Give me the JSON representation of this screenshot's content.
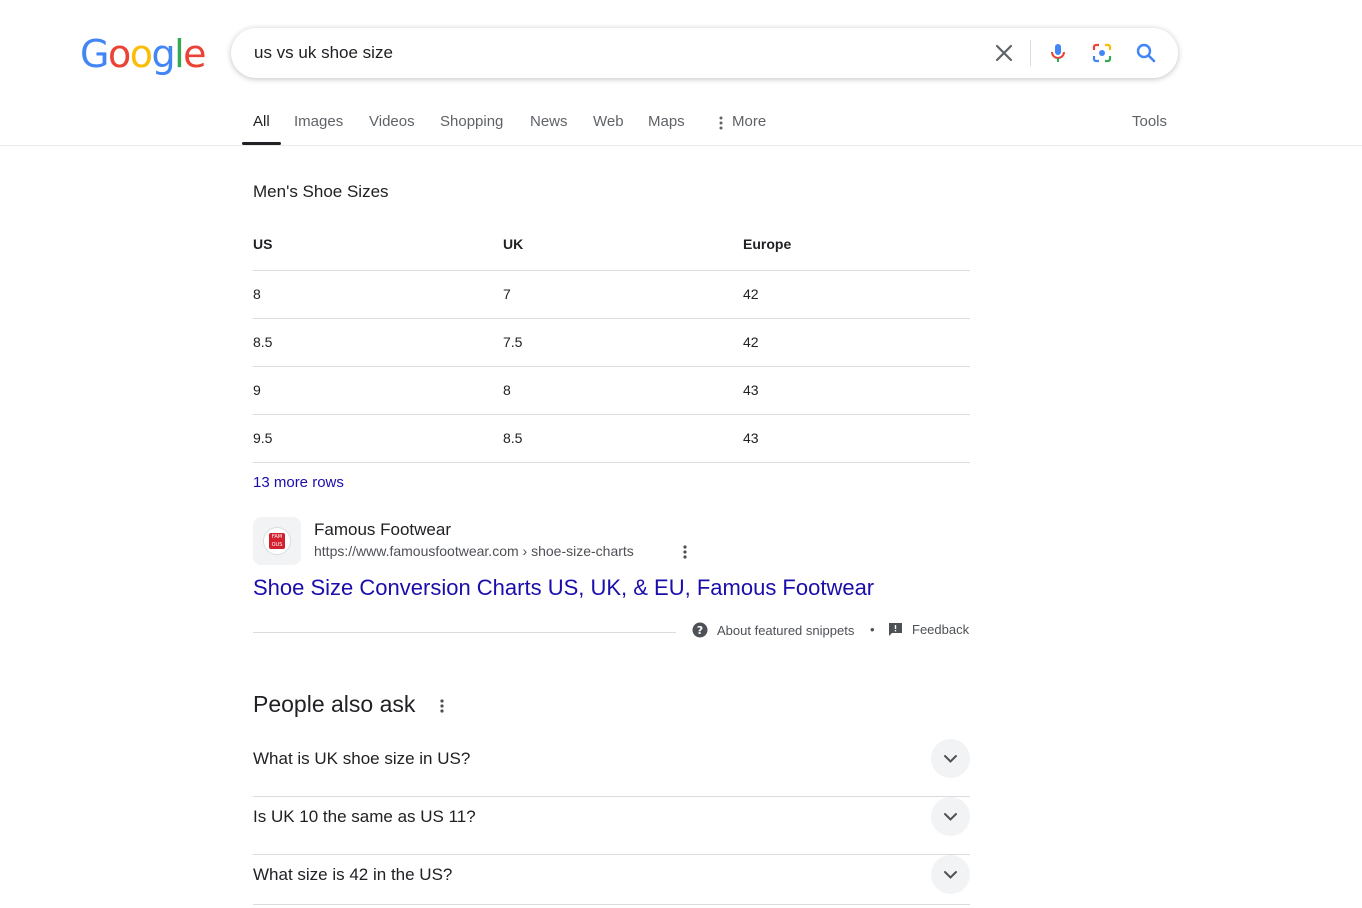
{
  "logo": {
    "text": "Google"
  },
  "search": {
    "query": "us vs uk shoe size"
  },
  "tabs": [
    {
      "label": "All"
    },
    {
      "label": "Images"
    },
    {
      "label": "Videos"
    },
    {
      "label": "Shopping"
    },
    {
      "label": "News"
    },
    {
      "label": "Web"
    },
    {
      "label": "Maps"
    },
    {
      "label": "More"
    }
  ],
  "tools_label": "Tools",
  "snippet": {
    "title": "Men's Shoe Sizes",
    "headers": [
      "US",
      "UK",
      "Europe"
    ],
    "rows": [
      [
        "8",
        "7",
        "42"
      ],
      [
        "8.5",
        "7.5",
        "42"
      ],
      [
        "9",
        "8",
        "43"
      ],
      [
        "9.5",
        "8.5",
        "43"
      ]
    ],
    "more_rows": "13 more rows",
    "favicon_text": "FAMOUS",
    "site_name": "Famous Footwear",
    "url": "https://www.famousfootwear.com › shoe-size-charts",
    "result_title": "Shoe Size Conversion Charts US, UK, & EU, Famous Footwear",
    "about_label": "About featured snippets",
    "separator": "•",
    "feedback_label": "Feedback"
  },
  "paa": {
    "title": "People also ask",
    "questions": [
      "What is UK shoe size in US?",
      "Is UK 10 the same as US 11?",
      "What size is 42 in the US?"
    ]
  },
  "colors": {
    "link": "#1a0dab",
    "google_blue": "#4285f4",
    "google_red": "#ea4335",
    "google_yellow": "#fbbc05",
    "google_green": "#34a853"
  }
}
